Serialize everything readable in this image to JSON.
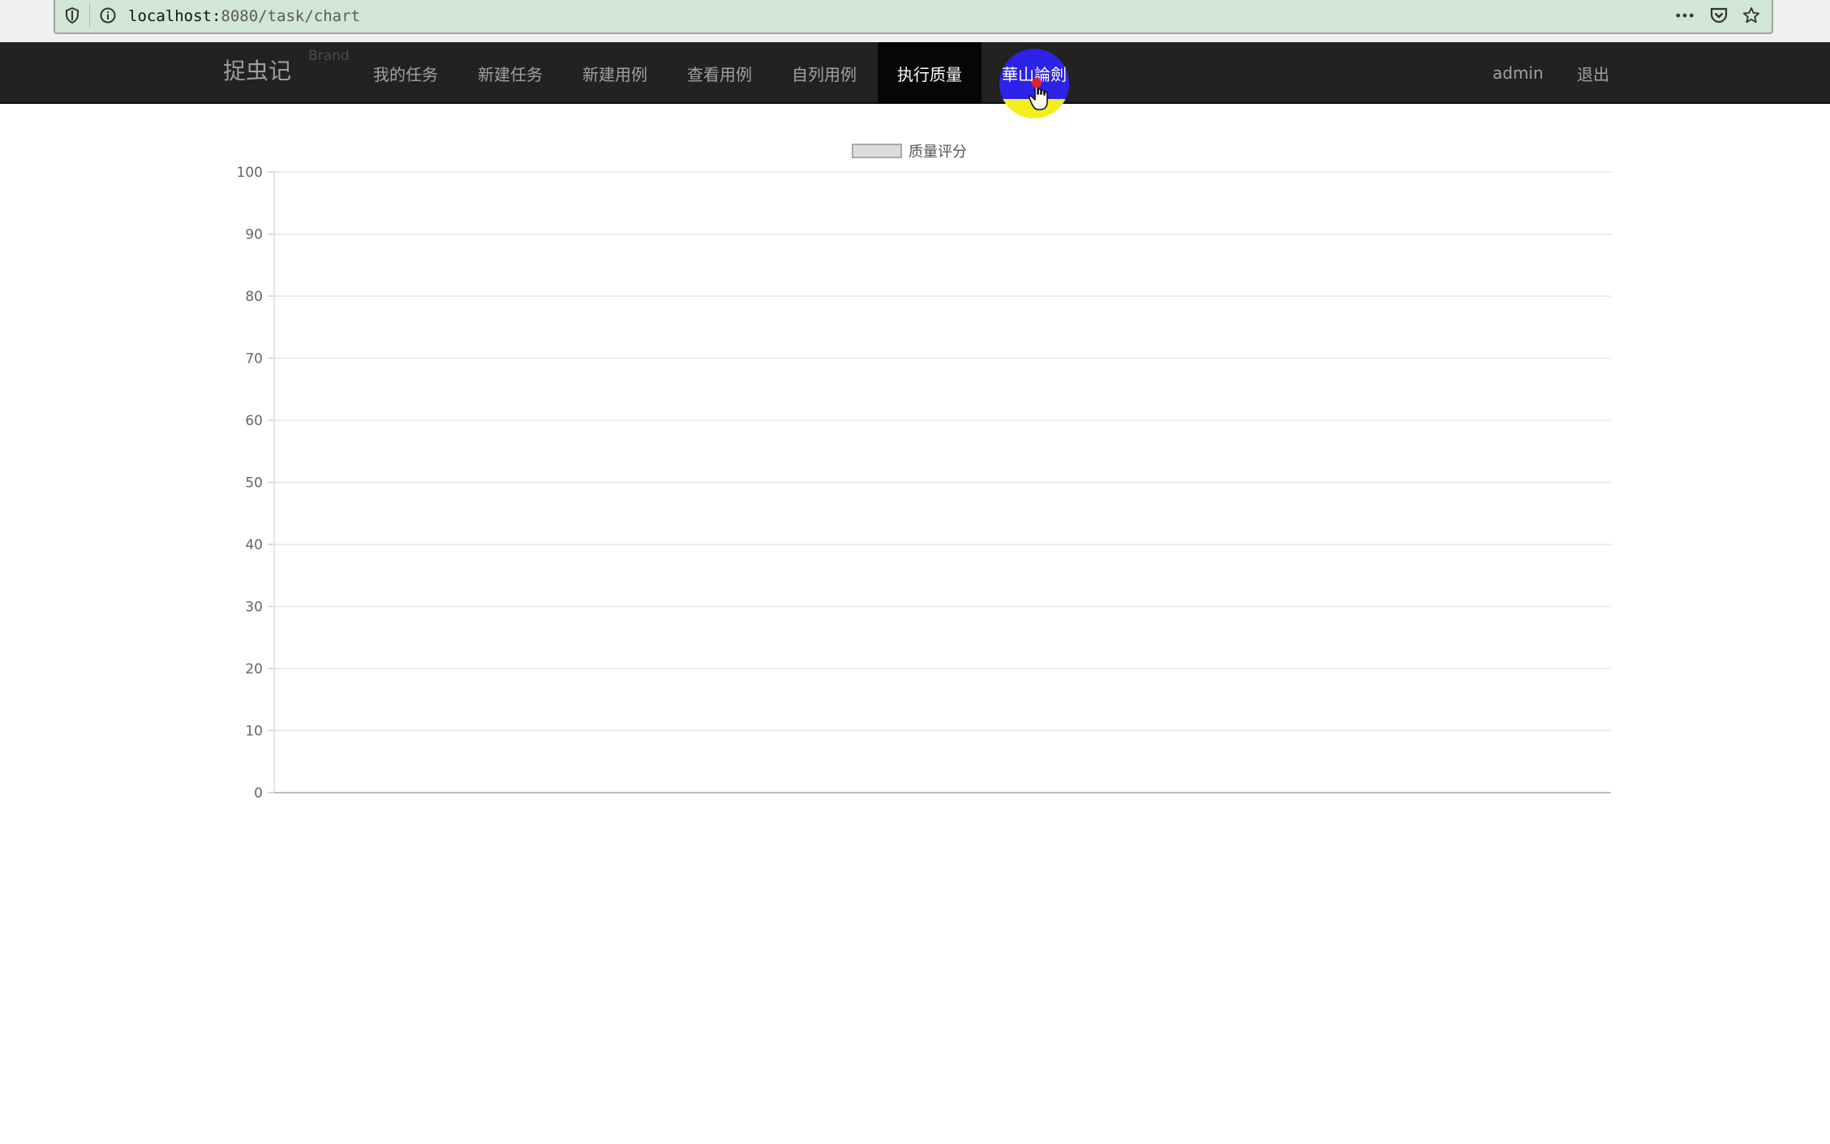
{
  "browser": {
    "url_host": "localhost:",
    "url_path": "8080/task/chart",
    "icons": [
      "shield-icon",
      "info-icon",
      "more-icon",
      "pocket-icon",
      "bookmark-star-icon"
    ]
  },
  "navbar": {
    "brand": "捉虫记",
    "brand_ghost": "Brand",
    "items": [
      {
        "label": "我的任务"
      },
      {
        "label": "新建任务"
      },
      {
        "label": "新建用例"
      },
      {
        "label": "查看用例"
      },
      {
        "label": "自列用例"
      },
      {
        "label": "执行质量",
        "active": true
      },
      {
        "label": "華山論劍"
      }
    ],
    "user": "admin",
    "logout": "退出",
    "colors": {
      "background": "#222222",
      "active": "#060606",
      "highlight_circle": "#2d22e8",
      "highlight_bottom": "#f3ef1e"
    }
  },
  "chart_data": {
    "type": "bar",
    "legend": [
      "质量评分"
    ],
    "legend_placement": "top-center",
    "series": [
      {
        "name": "质量评分",
        "values": []
      }
    ],
    "categories": [],
    "ylim": [
      0,
      100
    ],
    "yticks": [
      0,
      10,
      20,
      30,
      40,
      50,
      60,
      70,
      80,
      90,
      100
    ],
    "grid": true
  }
}
